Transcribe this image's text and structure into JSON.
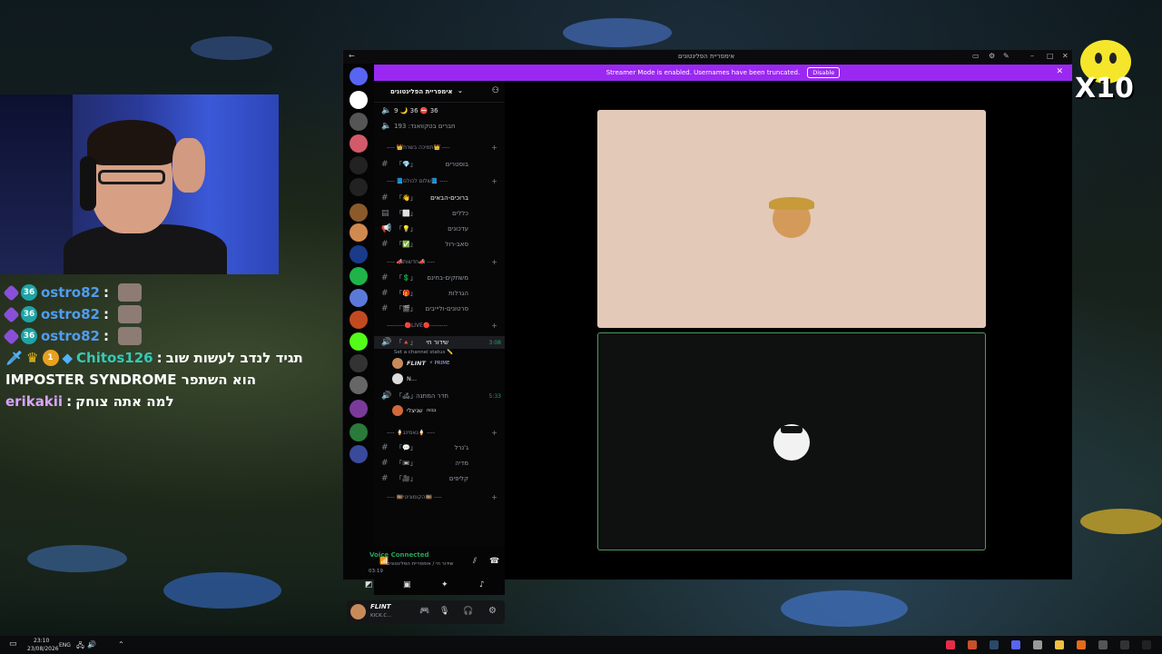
{
  "stream": {
    "chat": [
      {
        "user": "ostro82",
        "color": "#4f9cf0",
        "message": "",
        "badges": [
          "purple",
          "channel",
          "emote"
        ]
      },
      {
        "user": "ostro82",
        "color": "#4f9cf0",
        "message": "",
        "badges": [
          "purple",
          "channel",
          "emote"
        ]
      },
      {
        "user": "ostro82",
        "color": "#4f9cf0",
        "message": "",
        "badges": [
          "purple",
          "channel",
          "emote"
        ]
      },
      {
        "user": "Chitos126",
        "color": "#35c9b6",
        "message": "תגיד לנדב לעשות שוב",
        "badges": [
          "sword",
          "crown",
          "one",
          "cube"
        ]
      },
      {
        "user": "",
        "color": "#ffffff",
        "message": "IMPOSTER SYNDROME הוא השתפר",
        "badges": []
      },
      {
        "user": "erikakii",
        "color": "#d9a4ff",
        "message": "למה אתה צוחק",
        "badges": []
      }
    ],
    "overlay_x10": "X10"
  },
  "discord": {
    "window_title": "אימפריית הפלינטונים",
    "banner": {
      "text": "Streamer Mode is enabled. Usernames have been truncated.",
      "button": "Disable"
    },
    "guild_name": "אימפריית הפלינטונים",
    "stats": {
      "line1": "9 🌙 36 ⛔ 36",
      "line2": "חברים בטקוואנד: 193"
    },
    "categories": [
      {
        "label": "---- 👑תמיכה בשרת👑 ----"
      },
      {
        "label": "---- 📘שלום לכולם📘 ----"
      },
      {
        "label": "---- 📣חדשות📣 ----"
      },
      {
        "label": "---------🔴LIVE🔴---------"
      },
      {
        "label": "---- 🍦גאמינג🍦 ----"
      },
      {
        "label": "---- 🎞️הקומוניטי🎞️ ----"
      }
    ],
    "channels": {
      "boosters": "בוסטרים",
      "welcome": "ברוכים-הבאים",
      "rules": "כללים",
      "updates": "עדכונים",
      "selfroles": "סאב-רול",
      "giveaways": "משחקים-בחינם",
      "drops": "הגרלות",
      "clips_live": "סרטונים-וליייבים",
      "live_voice": "שידור חי",
      "live_status": "Set a channel status ✏️",
      "live_time": "3:08",
      "waiting_room": "חדר המתנה",
      "waiting_time": "5:33",
      "general": "ג'נרל",
      "media": "מדיה",
      "clips": "קליפים"
    },
    "voice_users": [
      {
        "name": "FLINT",
        "badge": "⚡ PRIME"
      },
      {
        "name": "N..."
      }
    ],
    "waiting_user": {
      "name": "שניצלי",
      "badge": "גבוה"
    },
    "voice_connected": {
      "status": "Voice Connected",
      "channel": "שידור חי / אימפריית הפלינטונים",
      "time": "03:19"
    },
    "user": {
      "name": "FLINT",
      "status": "KICK.C..."
    }
  },
  "taskbar": {
    "time": "23:10",
    "date": "23/08/2026",
    "lang": "ENG"
  }
}
